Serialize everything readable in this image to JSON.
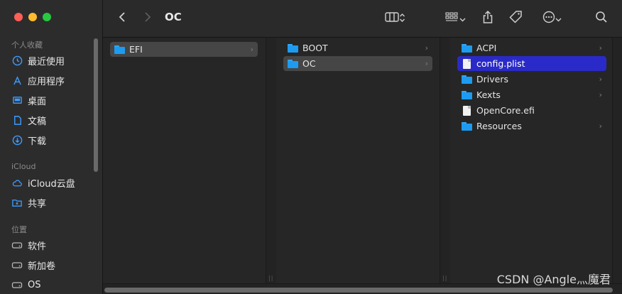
{
  "window": {
    "title": "OC"
  },
  "sidebar": {
    "sections": [
      {
        "heading": "个人收藏",
        "items": [
          {
            "label": "最近使用",
            "icon": "clock-icon"
          },
          {
            "label": "应用程序",
            "icon": "applications-icon"
          },
          {
            "label": "桌面",
            "icon": "desktop-icon"
          },
          {
            "label": "文稿",
            "icon": "document-icon"
          },
          {
            "label": "下载",
            "icon": "download-icon"
          }
        ]
      },
      {
        "heading": "iCloud",
        "items": [
          {
            "label": "iCloud云盘",
            "icon": "cloud-icon"
          },
          {
            "label": "共享",
            "icon": "shared-folder-icon"
          }
        ]
      },
      {
        "heading": "位置",
        "items": [
          {
            "label": "软件",
            "icon": "drive-icon"
          },
          {
            "label": "新加卷",
            "icon": "drive-icon"
          },
          {
            "label": "OS",
            "icon": "drive-icon"
          }
        ]
      }
    ]
  },
  "columns": [
    {
      "rows": [
        {
          "name": "EFI",
          "type": "folder",
          "selected": "grey",
          "has_children": true
        }
      ]
    },
    {
      "rows": [
        {
          "name": "BOOT",
          "type": "folder",
          "has_children": true
        },
        {
          "name": "OC",
          "type": "folder",
          "selected": "grey",
          "has_children": true
        }
      ]
    },
    {
      "rows": [
        {
          "name": "ACPI",
          "type": "folder",
          "has_children": true
        },
        {
          "name": "config.plist",
          "type": "file",
          "selected": "blue"
        },
        {
          "name": "Drivers",
          "type": "folder",
          "has_children": true
        },
        {
          "name": "Kexts",
          "type": "folder",
          "has_children": true
        },
        {
          "name": "OpenCore.efi",
          "type": "file"
        },
        {
          "name": "Resources",
          "type": "folder",
          "has_children": true
        }
      ]
    }
  ],
  "watermark": "CSDN @Angle灬魔君",
  "colors": {
    "selection_blue": "#2a2ac8",
    "folder_blue": "#1d9bf0",
    "selection_grey": "#464646"
  }
}
